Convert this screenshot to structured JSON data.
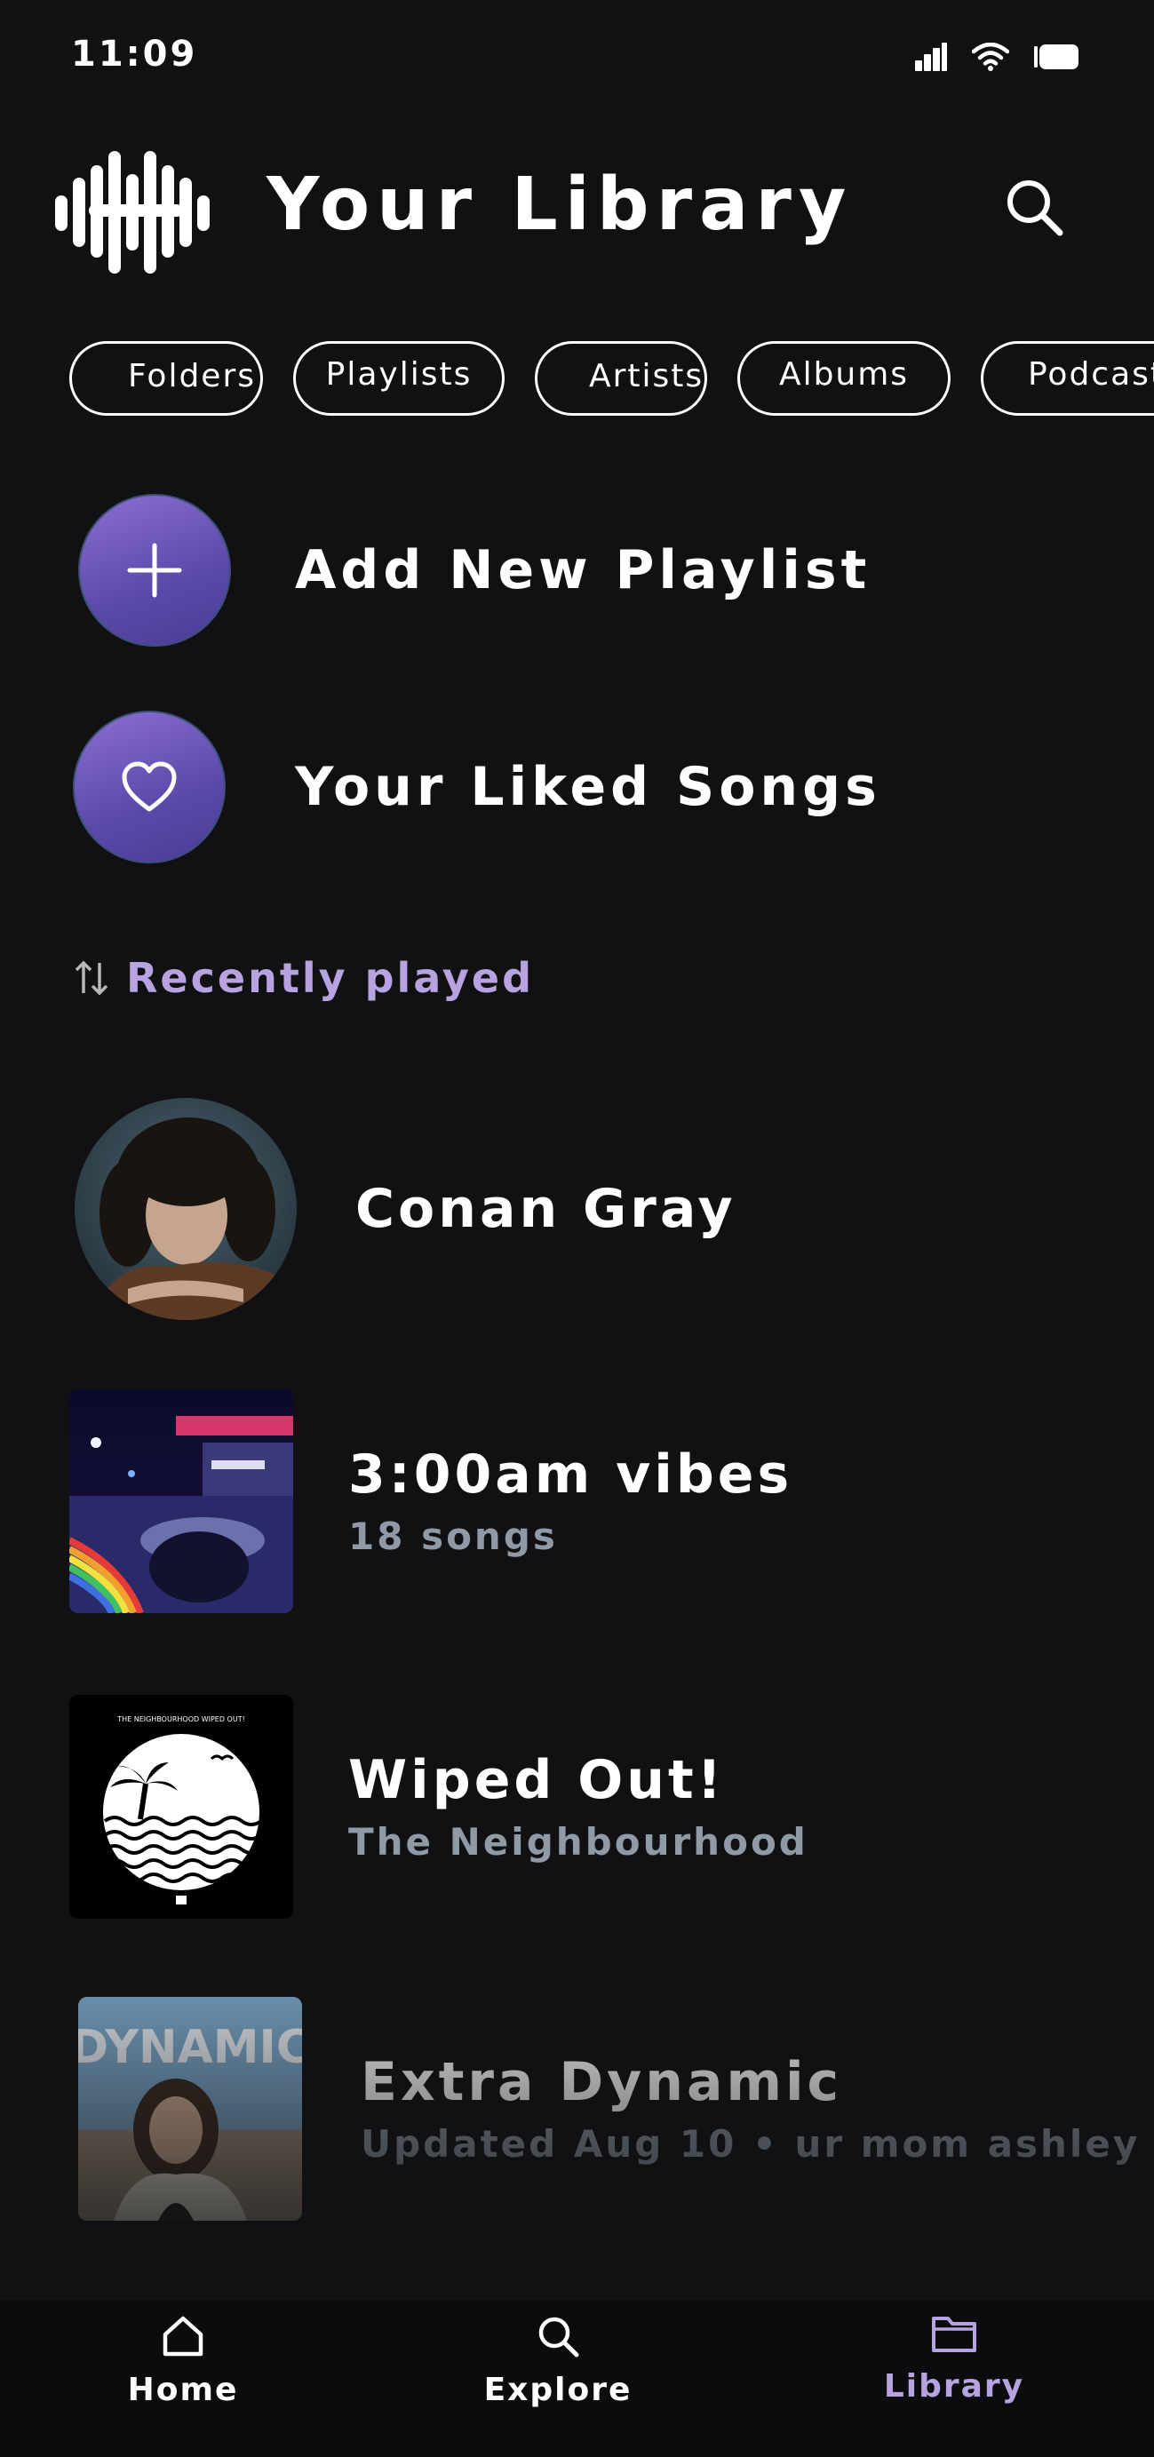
{
  "status_bar": {
    "time": "11:09"
  },
  "header": {
    "title": "Your Library"
  },
  "filters": [
    "Folders",
    "Playlists",
    "Artists",
    "Albums",
    "Podcasts"
  ],
  "actions": {
    "add_playlist_label": "Add New Playlist",
    "liked_songs_label": "Your Liked Songs"
  },
  "sort": {
    "label": "Recently played"
  },
  "library_items": [
    {
      "title": "Conan Gray",
      "subtitle": ""
    },
    {
      "title": "3:00am vibes",
      "subtitle": "18 songs"
    },
    {
      "title": "Wiped Out!",
      "subtitle": "The Neighbourhood"
    },
    {
      "title": "Extra Dynamic",
      "subtitle": "Updated Aug 10 • ur mom ashley"
    }
  ],
  "artwork_text": {
    "wiped_out_banner": "THE NEIGHBOURHOOD WIPED OUT!",
    "extra_dynamic_cover": "DYNAMIC"
  },
  "bottom_nav": {
    "home": "Home",
    "explore": "Explore",
    "library": "Library",
    "active": "library"
  },
  "colors": {
    "background": "#111113",
    "accent_purple": "#b7a3e0",
    "button_gradient_top": "#8b6fd4",
    "button_gradient_bottom": "#4b3c96",
    "subtitle_gray": "#8f9aa6"
  }
}
